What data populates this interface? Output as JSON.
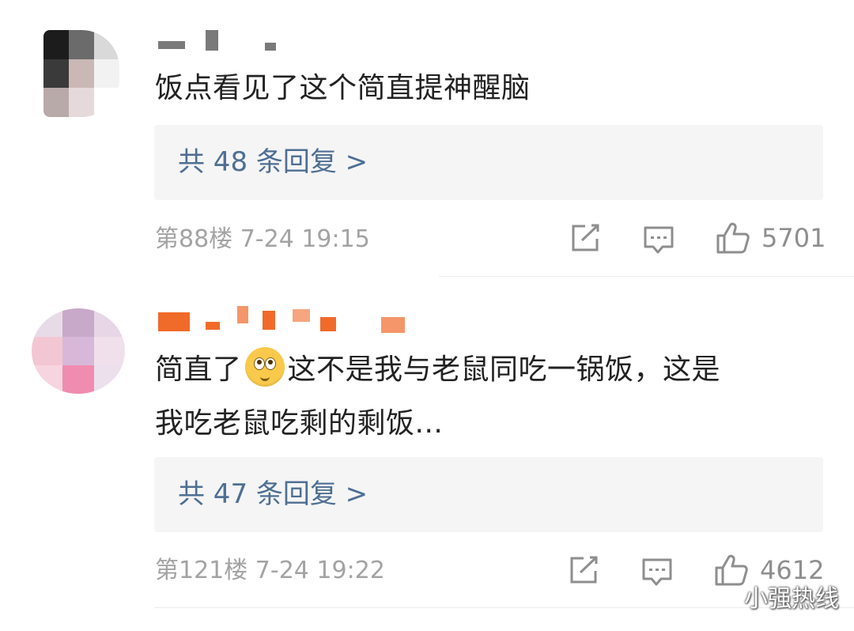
{
  "comments": [
    {
      "text_lines": [
        "饭点看见了这个简直提神醒脑"
      ],
      "reply_label": "共 48 条回复 >",
      "meta": "第88楼  7-24 19:15",
      "likes": "5701",
      "avatar_colors": [
        "#1c1c1c",
        "#6b6b6b",
        "#d9d9d9",
        "#3a3a3a",
        "#c9b8b5",
        "#f2f2f2",
        "#b8aaa8",
        "#e6d9dc",
        "#ffffff"
      ],
      "name_color": "#7a7a7a"
    },
    {
      "text_before_emoji": "简直了",
      "emoji_icon": "rolling-eyes-emoji-icon",
      "text_after_emoji": "这不是我与老鼠同吃一锅饭，这是",
      "text_line2": "我吃老鼠吃剩的剩饭...",
      "reply_label": "共 47 条回复 >",
      "meta": "第121楼  7-24 19:22",
      "likes": "4612",
      "avatar_colors": [
        "#e8dbe8",
        "#c9a9c9",
        "#e6d6e6",
        "#f3c6d3",
        "#d8b8d8",
        "#f0e0ec",
        "#f7d5e0",
        "#f08cb0",
        "#ece0ec"
      ],
      "name_color": "#f06a2a"
    }
  ],
  "icons": {
    "share": "share-icon",
    "comment": "comment-icon",
    "like": "thumbs-up-icon"
  },
  "watermark": {
    "icon": "wechat-icon",
    "text": "小强热线"
  }
}
